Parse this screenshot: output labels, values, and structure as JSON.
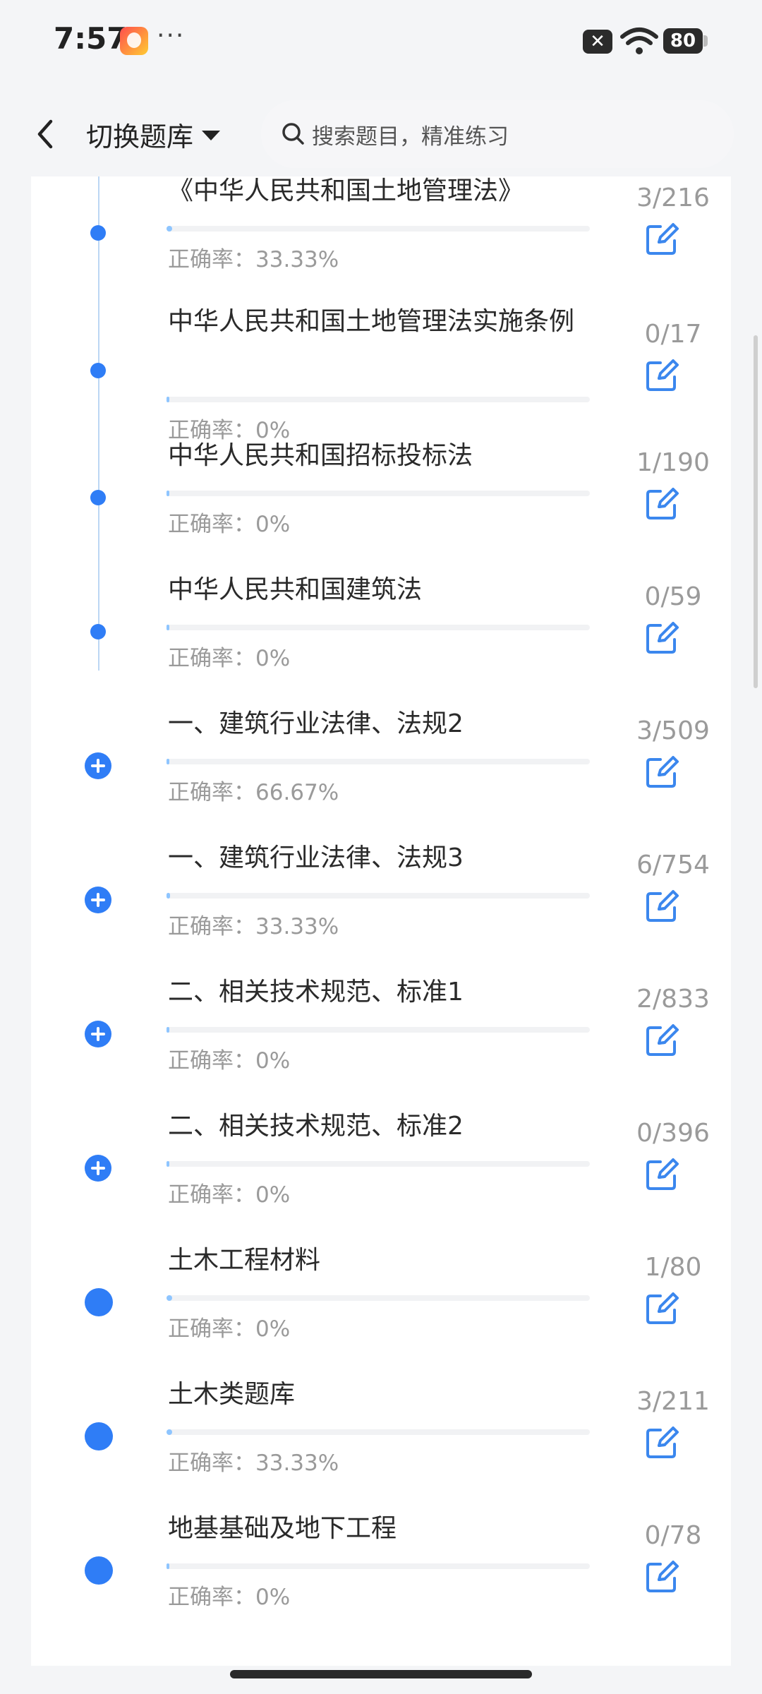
{
  "status_bar": {
    "time": "7:57",
    "dots": "···",
    "x_badge": "✕",
    "battery": "80",
    "icons": [
      "app-notification-icon",
      "close-box-icon",
      "wifi-icon",
      "battery-icon"
    ]
  },
  "header": {
    "back_icon": "chevron-left-icon",
    "switch_label": "切换题库",
    "search_placeholder": "搜索题目，精准练习"
  },
  "accuracy_prefix": "正确率：",
  "items": [
    {
      "title": "《中华人民共和国土地管理法》",
      "accuracy": "33.33%",
      "count": "3/216",
      "progress": 0.014,
      "marker": "small-dot"
    },
    {
      "title": "中华人民共和国土地管理法实施条例",
      "accuracy": "0%",
      "count": "0/17",
      "progress": 0.0,
      "marker": "small-dot"
    },
    {
      "title": "中华人民共和国招标投标法",
      "accuracy": "0%",
      "count": "1/190",
      "progress": 0.005,
      "marker": "small-dot"
    },
    {
      "title": "中华人民共和国建筑法",
      "accuracy": "0%",
      "count": "0/59",
      "progress": 0.0,
      "marker": "small-dot"
    },
    {
      "title": "一、建筑行业法律、法规2",
      "accuracy": "66.67%",
      "count": "3/509",
      "progress": 0.006,
      "marker": "plus"
    },
    {
      "title": "一、建筑行业法律、法规3",
      "accuracy": "33.33%",
      "count": "6/754",
      "progress": 0.008,
      "marker": "plus"
    },
    {
      "title": "二、相关技术规范、标准1",
      "accuracy": "0%",
      "count": "2/833",
      "progress": 0.002,
      "marker": "plus"
    },
    {
      "title": "二、相关技术规范、标准2",
      "accuracy": "0%",
      "count": "0/396",
      "progress": 0.0,
      "marker": "plus"
    },
    {
      "title": "土木工程材料",
      "accuracy": "0%",
      "count": "1/80",
      "progress": 0.0125,
      "marker": "big-dot"
    },
    {
      "title": "土木类题库",
      "accuracy": "33.33%",
      "count": "3/211",
      "progress": 0.014,
      "marker": "big-dot"
    },
    {
      "title": "地基基础及地下工程",
      "accuracy": "0%",
      "count": "0/78",
      "progress": 0.0,
      "marker": "big-dot"
    }
  ],
  "colors": {
    "accent": "#2f7df6",
    "progress_fill": "#8ec5ff",
    "muted": "#9a9a9a"
  }
}
